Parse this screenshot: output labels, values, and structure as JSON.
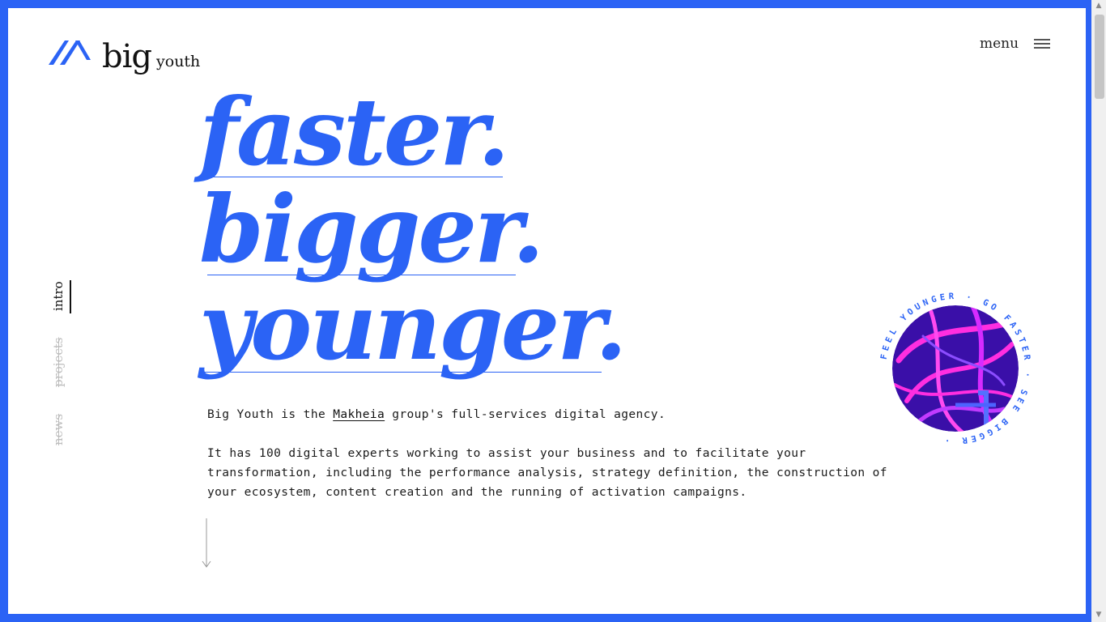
{
  "header": {
    "logo_big": "big",
    "logo_youth": "youth",
    "menu_label": "menu"
  },
  "sidenav": {
    "items": [
      {
        "label": "intro",
        "active": true
      },
      {
        "label": "projects",
        "active": false
      },
      {
        "label": "news",
        "active": false
      }
    ]
  },
  "hero": {
    "lines": [
      "faster.",
      "bigger.",
      "younger."
    ]
  },
  "intro": {
    "p1_before": "Big Youth is the ",
    "p1_link": "Makheia",
    "p1_after": " group's full-services digital agency.",
    "p2": "It has 100 digital experts working to assist your business and to facilitate your transformation, including the performance analysis, strategy definition, the construction of your ecosystem, content creation and the running of activation campaigns."
  },
  "badge": {
    "ring_text": "FEEL YOUNGER · GO FASTER · SEE BIGGER ·"
  },
  "colors": {
    "accent": "#2b63f5",
    "text": "#1a1a1a",
    "muted": "#bdbdbd",
    "badge_bg": "#3a0fa8",
    "badge_stroke": "#ff2ee0"
  },
  "icons": {
    "logo": "logo-mark-icon",
    "menu": "hamburger-icon",
    "scroll": "arrow-down-icon"
  }
}
